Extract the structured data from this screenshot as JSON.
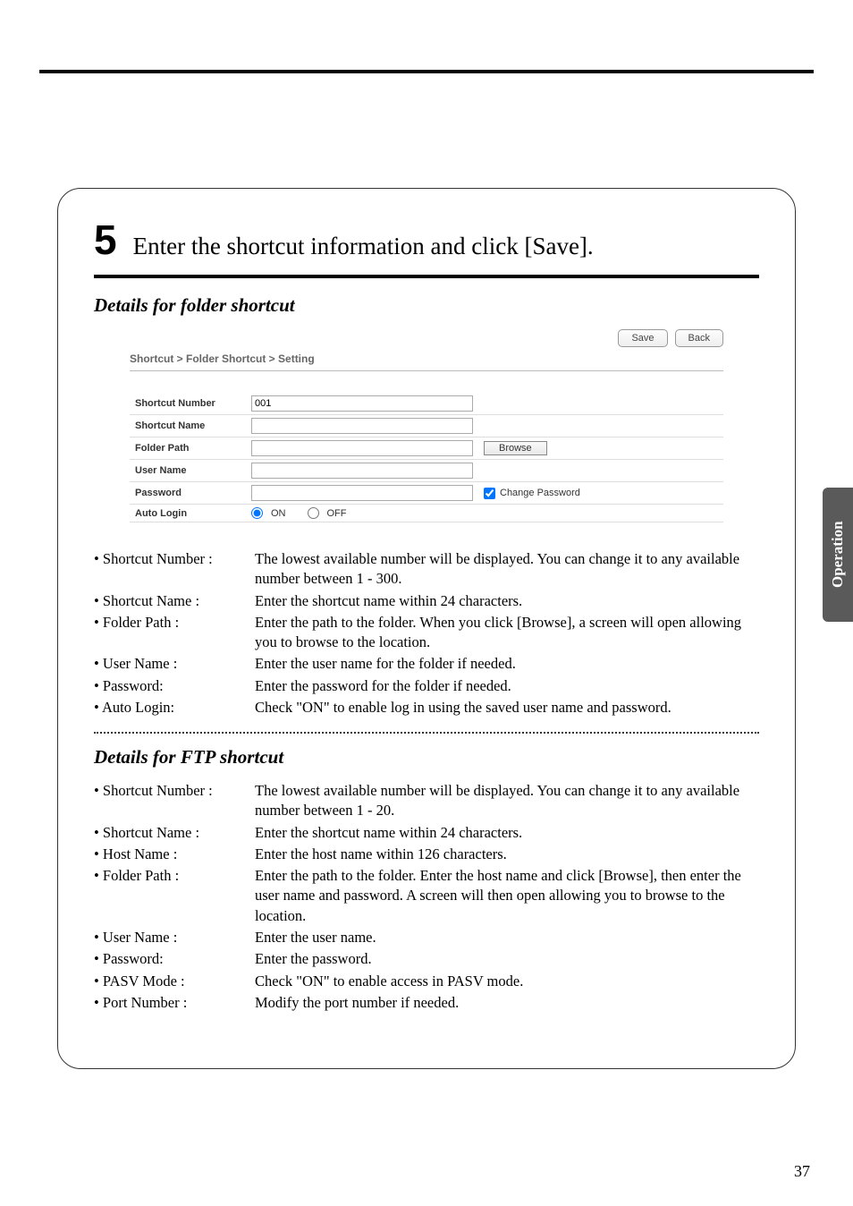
{
  "step": {
    "number": "5",
    "title": "Enter the shortcut information and click [Save]."
  },
  "folder_section": {
    "title": "Details for folder shortcut",
    "ui": {
      "save_btn": "Save",
      "back_btn": "Back",
      "breadcrumb": "Shortcut > Folder Shortcut > Setting",
      "rows": {
        "shortcut_number_label": "Shortcut Number",
        "shortcut_number_value": "001",
        "shortcut_name_label": "Shortcut Name",
        "folder_path_label": "Folder Path",
        "browse_btn": "Browse",
        "user_name_label": "User Name",
        "password_label": "Password",
        "change_password_label": "Change Password",
        "auto_login_label": "Auto Login",
        "on_label": "ON",
        "off_label": "OFF"
      }
    },
    "bullets": [
      {
        "label": "• Shortcut Number :",
        "desc": "The lowest available number will be displayed.  You can change it to any available number between 1 - 300."
      },
      {
        "label": "• Shortcut Name :",
        "desc": "Enter the shortcut name within 24 characters."
      },
      {
        "label": "• Folder Path :",
        "desc": "Enter the path to the folder.  When you click [Browse], a screen will open allowing you to browse to the location."
      },
      {
        "label": "• User Name :",
        "desc": "Enter the user name for the folder if needed."
      },
      {
        "label": "• Password:",
        "desc": "Enter the password for the folder if needed."
      },
      {
        "label": "• Auto Login:",
        "desc": "Check \"ON\" to enable log in using the saved user name and password."
      }
    ]
  },
  "ftp_section": {
    "title": "Details for FTP shortcut",
    "bullets": [
      {
        "label": "• Shortcut Number :",
        "desc": "The lowest available number will be displayed.  You can change it to any available number between 1 - 20."
      },
      {
        "label": "• Shortcut Name :",
        "desc": "Enter the shortcut name within 24 characters."
      },
      {
        "label": "• Host Name :",
        "desc": "Enter the host name within 126 characters."
      },
      {
        "label": "• Folder Path :",
        "desc": "Enter the path to the folder.  Enter the host name and click [Browse], then enter the user name and password.  A screen will then open allowing you to browse to the location."
      },
      {
        "label": "• User Name :",
        "desc": "Enter the user name."
      },
      {
        "label": "• Password:",
        "desc": "Enter the password."
      },
      {
        "label": "• PASV Mode :",
        "desc": "Check \"ON\" to enable access in PASV mode."
      },
      {
        "label": "• Port Number :",
        "desc": "Modify the port number if needed."
      }
    ]
  },
  "side_tab": "Operation",
  "page_number": "37"
}
